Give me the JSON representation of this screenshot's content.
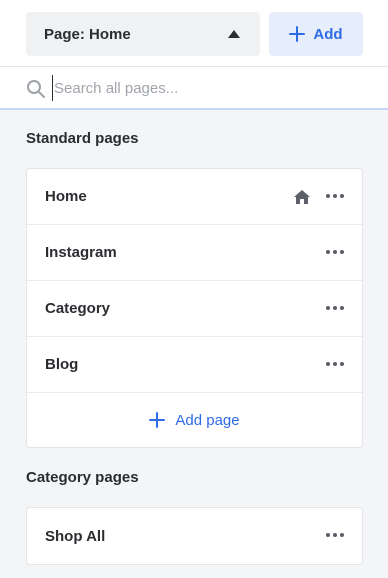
{
  "header": {
    "page_select_label": "Page: Home",
    "add_label": "Add"
  },
  "search": {
    "placeholder": "Search all pages..."
  },
  "standard_pages": {
    "title": "Standard pages",
    "items": [
      {
        "label": "Home",
        "is_home": true
      },
      {
        "label": "Instagram"
      },
      {
        "label": "Category"
      },
      {
        "label": "Blog"
      }
    ],
    "add_page_label": "Add page"
  },
  "category_pages": {
    "title": "Category pages",
    "items": [
      {
        "label": "Shop All"
      }
    ]
  },
  "colors": {
    "accent": "#2e6be6",
    "background": "#f4f5f7"
  },
  "icons": {
    "search": "search-icon",
    "home": "home-icon",
    "more": "more-options-icon",
    "plus": "plus-icon",
    "caret": "caret-up-icon"
  }
}
